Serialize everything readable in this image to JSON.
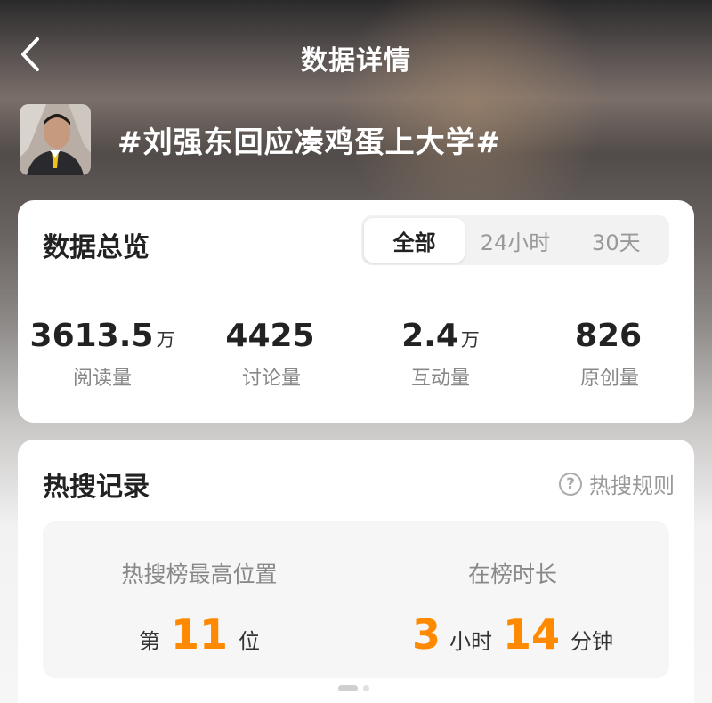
{
  "header": {
    "title": "数据详情"
  },
  "topic": {
    "title": "#刘强东回应凑鸡蛋上大学#"
  },
  "overview": {
    "heading": "数据总览",
    "tabs": [
      {
        "label": "全部",
        "active": true
      },
      {
        "label": "24小时",
        "active": false
      },
      {
        "label": "30天",
        "active": false
      }
    ],
    "stats": [
      {
        "value": "3613.5",
        "unit": "万",
        "label": "阅读量"
      },
      {
        "value": "4425",
        "unit": "",
        "label": "讨论量"
      },
      {
        "value": "2.4",
        "unit": "万",
        "label": "互动量"
      },
      {
        "value": "826",
        "unit": "",
        "label": "原创量"
      }
    ]
  },
  "hot_search": {
    "heading": "热搜记录",
    "rules_label": "热搜规则",
    "rules_icon": "?",
    "highest_position": {
      "caption": "热搜榜最高位置",
      "prefix": "第",
      "value": "11",
      "suffix": "位"
    },
    "duration": {
      "caption": "在榜时长",
      "hours": "3",
      "hours_unit": "小时",
      "minutes": "14",
      "minutes_unit": "分钟"
    }
  },
  "colors": {
    "accent": "#ff8a00"
  },
  "icons": {
    "back": "chevron-left-icon",
    "help": "question-circle-icon"
  }
}
